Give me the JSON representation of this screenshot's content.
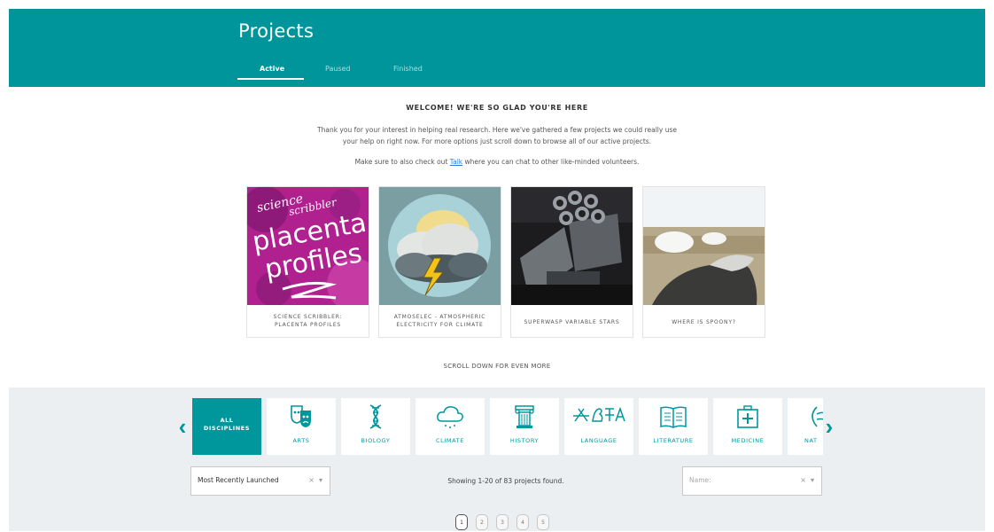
{
  "header": {
    "title": "Projects",
    "tabs": [
      {
        "label": "Active"
      },
      {
        "label": "Paused"
      },
      {
        "label": "Finished"
      }
    ]
  },
  "welcome": {
    "title": "WELCOME! WE'RE SO GLAD YOU'RE HERE",
    "body_line1": "Thank you for your interest in helping real research. Here we've gathered a few projects we could really use",
    "body_line2": "your help on right now. For more options just scroll down to browse all of our active projects.",
    "talk_before": "Make sure to also check out ",
    "talk_link": "Talk",
    "talk_after": " where you can chat to other like-minded volunteers."
  },
  "featured": [
    {
      "caption_line1": "SCIENCE SCRIBBLER:",
      "caption_line2": "PLACENTA PROFILES",
      "art_top": "science",
      "art_mid": "scribbler",
      "art_big1": "placenta",
      "art_big2": "profiles"
    },
    {
      "caption_line1": "ATMOSELEC - ATMOSPHERIC",
      "caption_line2": "ELECTRICITY FOR CLIMATE"
    },
    {
      "caption_line1": "SUPERWASP VARIABLE STARS",
      "caption_line2": ""
    },
    {
      "caption_line1": "WHERE IS SPOONY?",
      "caption_line2": ""
    }
  ],
  "scroll_more": "SCROLL DOWN FOR EVEN MORE",
  "disciplines": [
    {
      "label_line1": "ALL",
      "label_line2": "DISCIPLINES",
      "icon": "none"
    },
    {
      "label": "ARTS",
      "icon": "theater-masks-icon"
    },
    {
      "label": "BIOLOGY",
      "icon": "dna-icon"
    },
    {
      "label": "CLIMATE",
      "icon": "cloud-rain-icon"
    },
    {
      "label": "HISTORY",
      "icon": "column-icon"
    },
    {
      "label": "LANGUAGE",
      "icon": "script-icon"
    },
    {
      "label": "LITERATURE",
      "icon": "open-book-icon"
    },
    {
      "label": "MEDICINE",
      "icon": "medical-kit-icon"
    },
    {
      "label": "NAT",
      "icon": "nature-icon"
    }
  ],
  "nav": {
    "prev": "‹",
    "next": "›"
  },
  "sort_select": {
    "value": "Most Recently Launched",
    "clear": "×",
    "caret": "▾"
  },
  "results_text": "Showing 1-20 of 83 projects found.",
  "name_select": {
    "placeholder": "Name:",
    "clear": "×",
    "caret": "▾"
  },
  "pagination": [
    "1",
    "2",
    "3",
    "4",
    "5"
  ],
  "colors": {
    "teal": "#00959a",
    "link": "#2b7bd6",
    "panel": "#ebeff2"
  }
}
